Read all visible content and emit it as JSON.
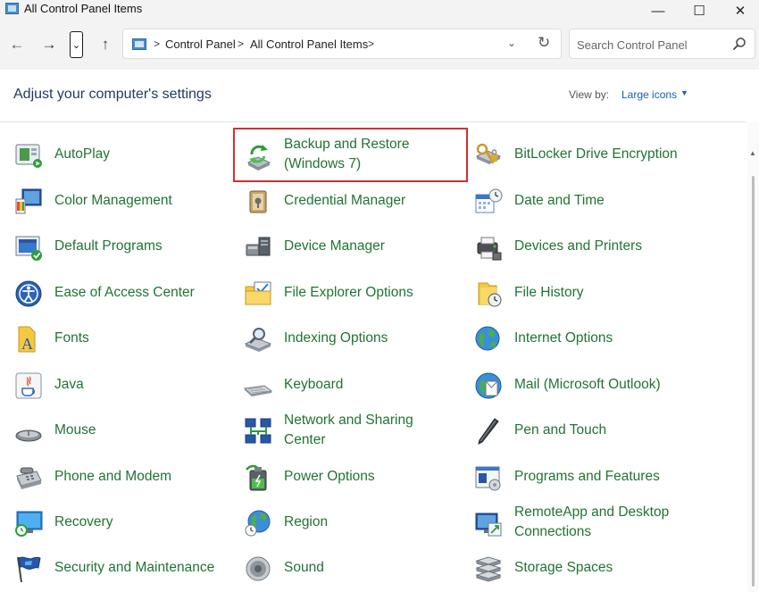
{
  "window": {
    "title": "All Control Panel Items",
    "minimize_glyph": "—",
    "maximize_glyph": "☐",
    "close_glyph": "✕"
  },
  "nav": {
    "back_glyph": "←",
    "forward_glyph": "→",
    "recent_glyph": "⌄",
    "up_glyph": "↑"
  },
  "address": {
    "breadcrumbs": [
      "Control Panel",
      "All Control Panel Items"
    ],
    "separator": ">",
    "dropdown_glyph": "⌄",
    "refresh_glyph": "↻"
  },
  "search": {
    "placeholder": "Search Control Panel"
  },
  "header": {
    "title": "Adjust your computer's settings",
    "view_by_label": "View by:",
    "view_by_value": "Large icons",
    "view_by_arrow": "▼"
  },
  "highlighted_item": "Backup and Restore (Windows 7)",
  "colors": {
    "item_text": "#227332",
    "heading_text": "#1e3a5f",
    "link_blue": "#1a5fb4",
    "highlight_border": "#d32f2f",
    "chrome_bg": "#f3f3f3"
  },
  "items": [
    {
      "label": "AutoPlay",
      "icon": "autoplay-icon"
    },
    {
      "label": "Backup and Restore (Windows 7)",
      "icon": "backup-restore-icon"
    },
    {
      "label": "BitLocker Drive Encryption",
      "icon": "bitlocker-icon"
    },
    {
      "label": "Color Management",
      "icon": "color-management-icon"
    },
    {
      "label": "Credential Manager",
      "icon": "credential-manager-icon"
    },
    {
      "label": "Date and Time",
      "icon": "date-time-icon"
    },
    {
      "label": "Default Programs",
      "icon": "default-programs-icon"
    },
    {
      "label": "Device Manager",
      "icon": "device-manager-icon"
    },
    {
      "label": "Devices and Printers",
      "icon": "devices-printers-icon"
    },
    {
      "label": "Ease of Access Center",
      "icon": "ease-of-access-icon"
    },
    {
      "label": "File Explorer Options",
      "icon": "file-explorer-options-icon"
    },
    {
      "label": "File History",
      "icon": "file-history-icon"
    },
    {
      "label": "Fonts",
      "icon": "fonts-icon"
    },
    {
      "label": "Indexing Options",
      "icon": "indexing-options-icon"
    },
    {
      "label": "Internet Options",
      "icon": "internet-options-icon"
    },
    {
      "label": "Java",
      "icon": "java-icon"
    },
    {
      "label": "Keyboard",
      "icon": "keyboard-icon"
    },
    {
      "label": "Mail (Microsoft Outlook)",
      "icon": "mail-icon"
    },
    {
      "label": "Mouse",
      "icon": "mouse-icon"
    },
    {
      "label": "Network and Sharing Center",
      "icon": "network-sharing-icon"
    },
    {
      "label": "Pen and Touch",
      "icon": "pen-touch-icon"
    },
    {
      "label": "Phone and Modem",
      "icon": "phone-modem-icon"
    },
    {
      "label": "Power Options",
      "icon": "power-options-icon"
    },
    {
      "label": "Programs and Features",
      "icon": "programs-features-icon"
    },
    {
      "label": "Recovery",
      "icon": "recovery-icon"
    },
    {
      "label": "Region",
      "icon": "region-icon"
    },
    {
      "label": "RemoteApp and Desktop Connections",
      "icon": "remoteapp-icon"
    },
    {
      "label": "Security and Maintenance",
      "icon": "security-maintenance-icon"
    },
    {
      "label": "Sound",
      "icon": "sound-icon"
    },
    {
      "label": "Storage Spaces",
      "icon": "storage-spaces-icon"
    }
  ]
}
